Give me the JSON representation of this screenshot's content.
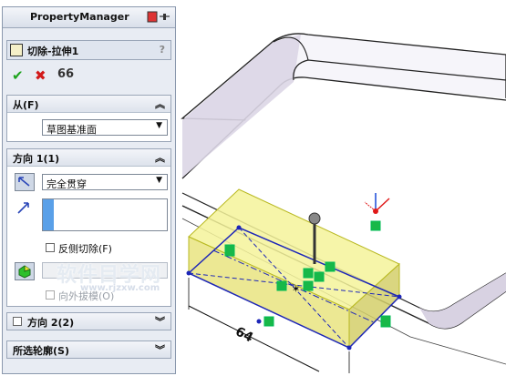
{
  "panel": {
    "title": "PropertyManager",
    "feature_name": "切除-拉伸1",
    "help": "?",
    "actions": {
      "ok": "✔",
      "cancel": "✖",
      "preview": "66"
    },
    "from": {
      "header": "从(F)",
      "value": "草图基准面"
    },
    "direction1": {
      "header": "方向 1(1)",
      "end_condition": "完全贯穿",
      "flip_side_label": "反侧切除(F)",
      "draft_outward_label": "向外拔模(O)"
    },
    "direction2": {
      "header": "方向 2(2)"
    },
    "selected_contours": {
      "header": "所选轮廓(S)"
    }
  },
  "viewport": {
    "dimension": "64",
    "colors": {
      "preview": "#f4f39a",
      "sketch": "#1d26b8",
      "handle": "#18b848",
      "x_axis": "#e01818",
      "y_axis": "#1848d8"
    }
  },
  "watermark": {
    "text": "软件目学网",
    "url": "www.rjzxw.com"
  }
}
